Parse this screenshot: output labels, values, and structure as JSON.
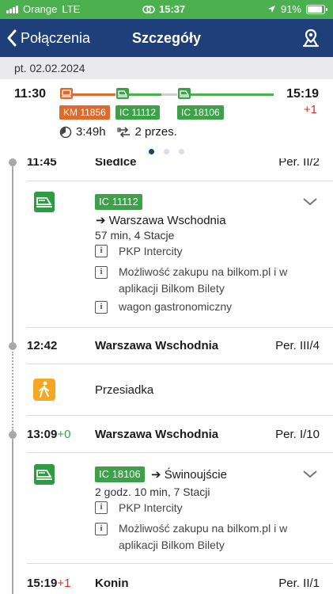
{
  "status_bar": {
    "carrier": "Orange",
    "network": "LTE",
    "time": "15:37",
    "battery": "91%",
    "battery_level": 0.91
  },
  "nav": {
    "back_label": "Połączenia",
    "title": "Szczegóły"
  },
  "date": "pt. 02.02.2024",
  "summary": {
    "departure": "11:30",
    "arrival": "15:19",
    "arrival_offset": "+1",
    "trains": [
      "KM 11856",
      "IC 11112",
      "IC 18106"
    ],
    "duration": "3:49h",
    "transfers": "2 przes."
  },
  "list": {
    "top_stop": {
      "time": "11:45",
      "station": "Siedlce",
      "platform": "Per. II/2"
    },
    "train1": {
      "badge": "IC 11112",
      "direction": "➔ Warszawa Wschodnia",
      "duration": "57 min, 4 Stacje",
      "info": [
        "PKP Intercity",
        "Możliwość zakupu na bilkom.pl i w",
        "aplikacji Bilkom Bilety",
        "wagon gastronomiczny"
      ]
    },
    "stop2": {
      "time": "12:42",
      "station": "Warszawa Wschodnia",
      "platform": "Per. III/4"
    },
    "transfer_label": "Przesiadka",
    "stop3": {
      "time": "13:09",
      "delay": "+0",
      "station": "Warszawa Wschodnia",
      "platform": "Per. I/10"
    },
    "train2": {
      "badge": "IC 18106",
      "direction": "➔ Świnoujście",
      "duration": "2 godz. 10 min, 7 Stacji",
      "info": [
        "PKP Intercity",
        "Możliwość zakupu na bilkom.pl i w",
        "aplikacji Bilkom Bilety"
      ]
    },
    "stop4": {
      "time": "15:19",
      "delay": "+1",
      "station": "Konin",
      "platform": "Per. II/1"
    }
  },
  "colors": {
    "nav_bg": "#1e3f7a",
    "status_bg": "#4caf50",
    "km_orange": "#e06a2c",
    "ic_green": "#3ca148",
    "delay_red": "#d0312d"
  }
}
